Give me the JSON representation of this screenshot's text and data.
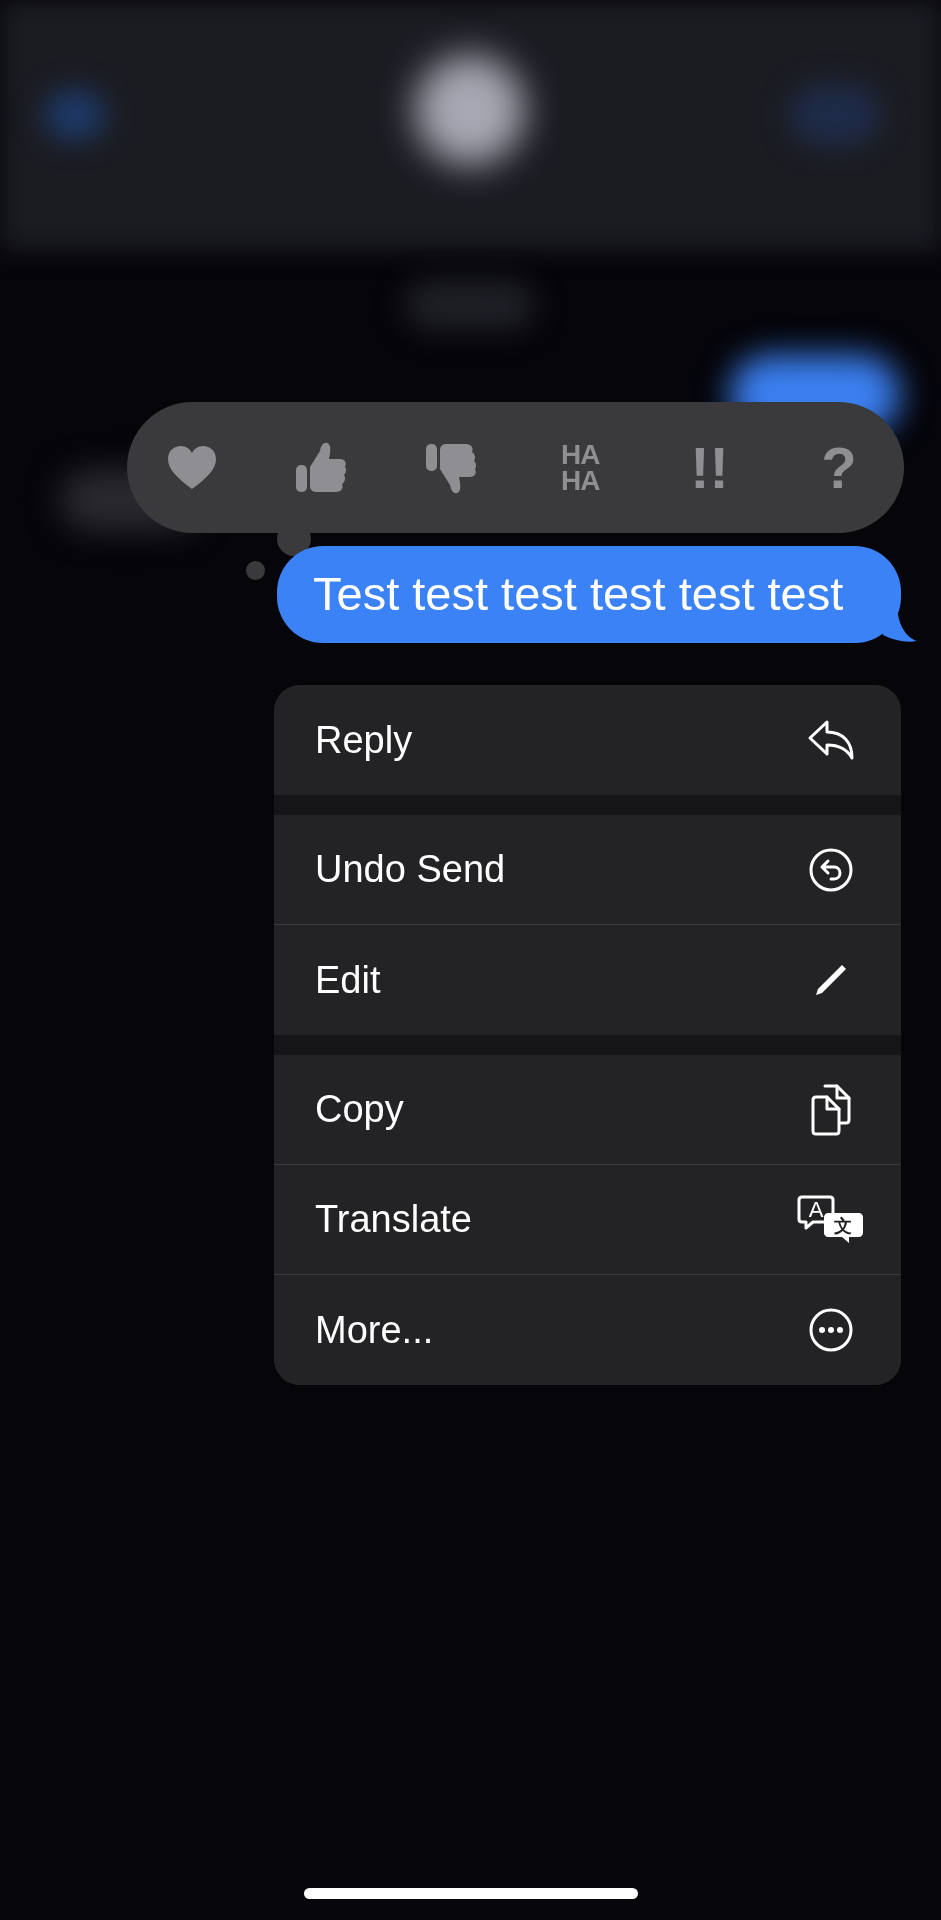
{
  "tapbacks": [
    {
      "kind": "heart"
    },
    {
      "kind": "thumbs_up"
    },
    {
      "kind": "thumbs_down"
    },
    {
      "kind": "text",
      "lines": [
        "HA",
        "HA"
      ]
    },
    {
      "kind": "text",
      "lines": [
        "!!"
      ]
    },
    {
      "kind": "text",
      "lines": [
        "?"
      ]
    }
  ],
  "message": {
    "text": "Test test test test test test"
  },
  "menu_groups": [
    [
      {
        "label": "Reply",
        "kind": "reply"
      }
    ],
    [
      {
        "label": "Undo Send",
        "kind": "undo"
      },
      {
        "label": "Edit",
        "kind": "edit"
      }
    ],
    [
      {
        "label": "Copy",
        "kind": "copy"
      },
      {
        "label": "Translate",
        "kind": "translate",
        "glyphs": [
          "A",
          "文"
        ]
      },
      {
        "label": "More...",
        "kind": "more"
      }
    ]
  ]
}
